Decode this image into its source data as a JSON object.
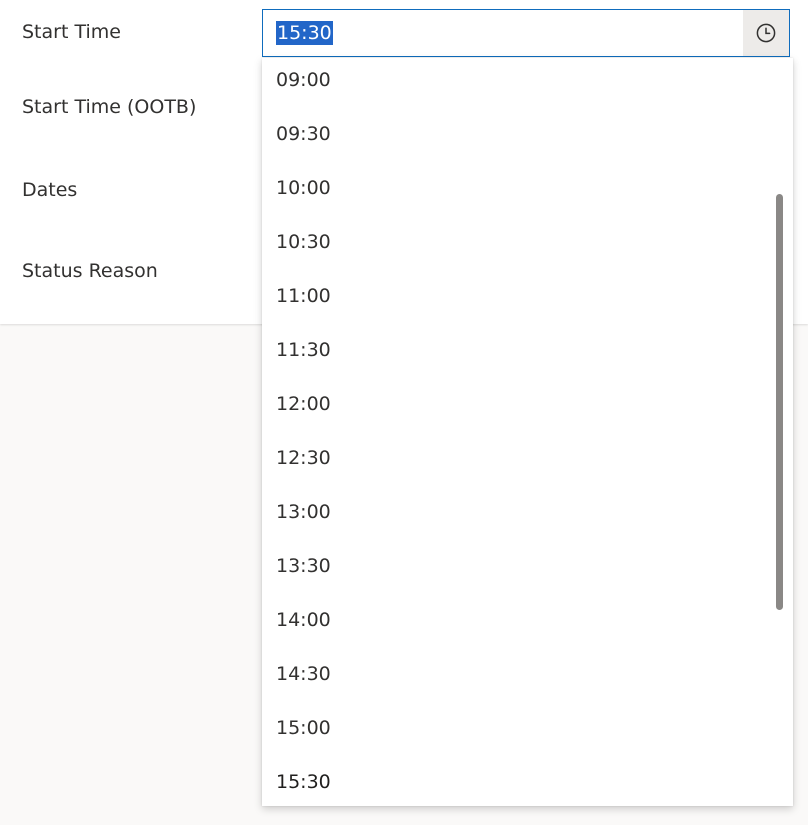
{
  "form": {
    "labels": {
      "start_time": "Start Time",
      "start_time_ootb": "Start Time (OOTB)",
      "dates": "Dates",
      "status_reason": "Status Reason"
    },
    "start_time_field": {
      "value": "15:30",
      "clock_icon": "clock-icon"
    }
  },
  "time_dropdown": {
    "options": [
      "09:00",
      "09:30",
      "10:00",
      "10:30",
      "11:00",
      "11:30",
      "12:00",
      "12:30",
      "13:00",
      "13:30",
      "14:00",
      "14:30",
      "15:00",
      "15:30"
    ],
    "selected": "15:30"
  },
  "colors": {
    "focus_border": "#0f6cbd",
    "selection_highlight": "#2266c8",
    "page_background": "#faf9f8",
    "scrollbar_thumb": "#8a8886"
  }
}
